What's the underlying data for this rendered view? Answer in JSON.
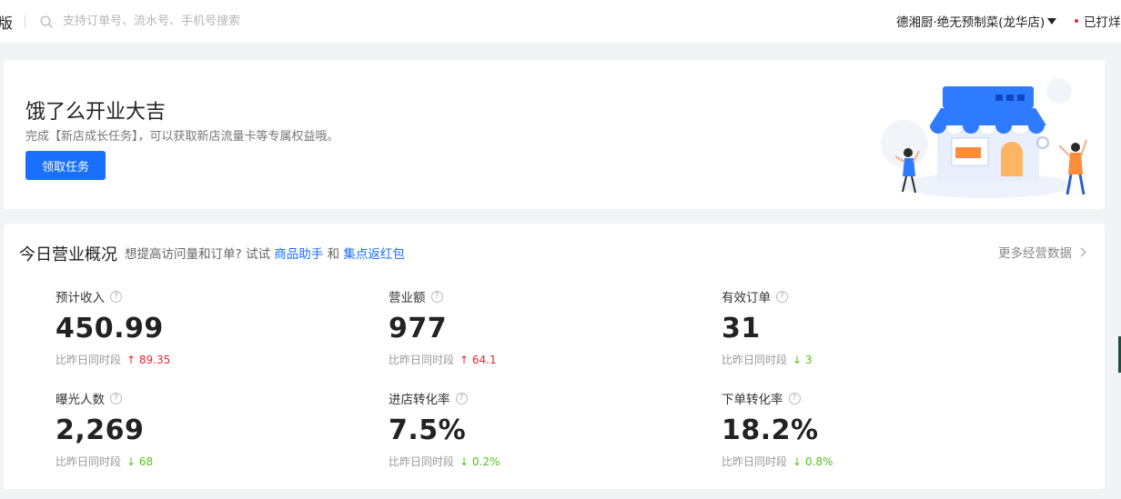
{
  "header": {
    "brand_tail": "版",
    "search_placeholder": "支持订单号、流水号、手机号搜索",
    "store_name": "德湘厨·绝无预制菜(龙华店)",
    "print_status": "已打烊"
  },
  "banner": {
    "title": "饿了么开业大吉",
    "description": "完成【新店成长任务】，可以获取新店流量卡等专属权益哦。",
    "button_label": "领取任务"
  },
  "overview": {
    "title": "今日营业概况",
    "hint_prefix": "想提高访问量和订单? 试试",
    "link1": "商品助手",
    "hint_and": "和",
    "link2": "集点返红包",
    "more_label": "更多经营数据",
    "compare_label": "比昨日同时段",
    "metrics": [
      {
        "label": "预计收入",
        "value": "450.99",
        "delta": "↑ 89.35",
        "trend": "up"
      },
      {
        "label": "营业额",
        "value": "977",
        "delta": "↑ 64.1",
        "trend": "up"
      },
      {
        "label": "有效订单",
        "value": "31",
        "delta": "↓ 3",
        "trend": "down"
      },
      {
        "label": "曝光人数",
        "value": "2,269",
        "delta": "↓ 68",
        "trend": "down"
      },
      {
        "label": "进店转化率",
        "value": "7.5%",
        "delta": "↓ 0.2%",
        "trend": "down"
      },
      {
        "label": "下单转化率",
        "value": "18.2%",
        "delta": "↓ 0.8%",
        "trend": "down"
      }
    ]
  },
  "colors": {
    "accent": "#1a6fff",
    "up": "#f5222d",
    "down": "#52c41a"
  },
  "icons": [
    "search-icon",
    "caret-down-icon",
    "red-dot-icon",
    "help-icon",
    "chevron-right-icon",
    "store-illustration"
  ]
}
